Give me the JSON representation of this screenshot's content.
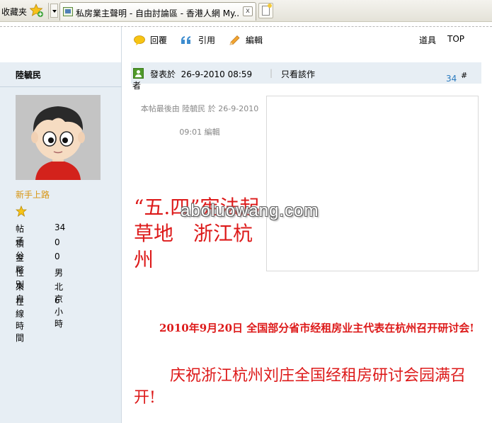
{
  "browser": {
    "favorites_label": "收藏夹",
    "tab_title": "私房業主聲明 - 自由討論區 - 香港人網 My...",
    "tab_close": "x"
  },
  "toolbar": {
    "reply": "回覆",
    "quote": "引用",
    "edit": "編輯",
    "tools": "道具",
    "top": "TOP"
  },
  "author": {
    "name": "陸毓民",
    "rank": "新手上路",
    "stats": [
      {
        "label": "帖子",
        "value": "34"
      },
      {
        "label": "積分",
        "value": "0"
      },
      {
        "label": "金幣",
        "value": "0"
      },
      {
        "label": "性別",
        "value": "男"
      },
      {
        "label": "來自",
        "value": "北京"
      },
      {
        "label": "在線時間",
        "value": "6 小時"
      }
    ]
  },
  "post": {
    "posted_prefix": "發表於",
    "posted_time": "26-9-2010 08:59",
    "separator": "|",
    "only_author_a": "只看該作",
    "only_author_b": "者",
    "floor": "34",
    "floor_hash": "#",
    "edit_note": "本帖最後由 陸毓民 於 26-9-2010 09:01 編輯",
    "headline": "“五.四”宪法起草地　浙江杭州",
    "watermark": "aboluowang.com",
    "para1": "2010年9月20日 全国部分省市经租房业主代表在杭州召开研讨会!",
    "para2": "庆祝浙江杭州刘庄全国经租房研讨会园满召开!"
  },
  "colors": {
    "accent_red": "#dd1a1a",
    "rank_gold": "#d79410",
    "floor_blue": "#2b7bbf",
    "sidebar_bg": "#e7eef4"
  }
}
